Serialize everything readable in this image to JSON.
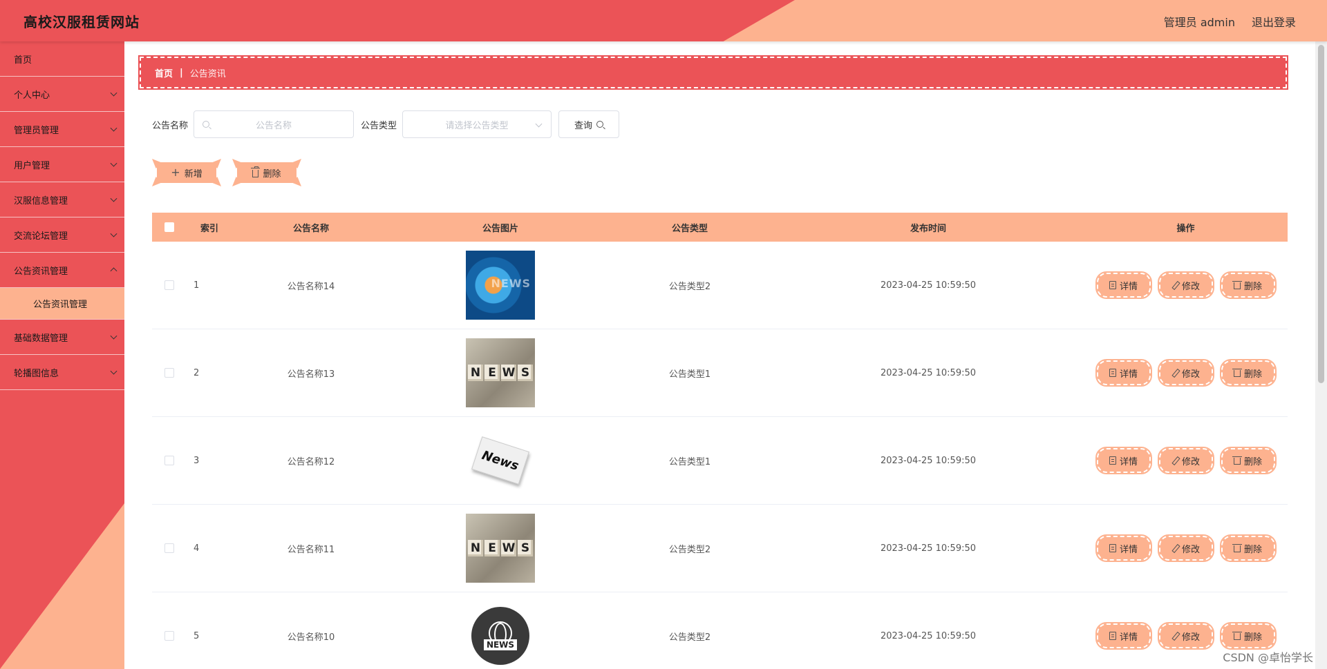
{
  "header": {
    "site_title": "高校汉服租赁网站",
    "user_label": "管理员 admin",
    "logout_label": "退出登录"
  },
  "sidebar": {
    "items": [
      {
        "label": "首页"
      },
      {
        "label": "个人中心"
      },
      {
        "label": "管理员管理"
      },
      {
        "label": "用户管理"
      },
      {
        "label": "汉服信息管理"
      },
      {
        "label": "交流论坛管理"
      },
      {
        "label": "公告资讯管理"
      },
      {
        "label": "基础数据管理"
      },
      {
        "label": "轮播图信息"
      }
    ],
    "submenu_label": "公告资讯管理"
  },
  "breadcrumb": {
    "home": "首页",
    "separator": "|",
    "current": "公告资讯"
  },
  "search": {
    "name_label": "公告名称",
    "name_placeholder": "公告名称",
    "type_label": "公告类型",
    "type_placeholder": "请选择公告类型",
    "query_label": "查询"
  },
  "actions": {
    "add_label": "新增",
    "delete_label": "删除"
  },
  "table": {
    "headers": [
      "索引",
      "公告名称",
      "公告图片",
      "公告类型",
      "发布时间",
      "操作"
    ],
    "rows": [
      {
        "index": "1",
        "name": "公告名称14",
        "image": "news-globe-image",
        "type": "公告类型2",
        "time": "2023-04-25 10:59:50"
      },
      {
        "index": "2",
        "name": "公告名称13",
        "image": "news-cubes-image",
        "type": "公告类型1",
        "time": "2023-04-25 10:59:50"
      },
      {
        "index": "3",
        "name": "公告名称12",
        "image": "newspaper-image",
        "type": "公告类型1",
        "time": "2023-04-25 10:59:50"
      },
      {
        "index": "4",
        "name": "公告名称11",
        "image": "news-cubes-image",
        "type": "公告类型2",
        "time": "2023-04-25 10:59:50"
      },
      {
        "index": "5",
        "name": "公告名称10",
        "image": "news-globe-badge-image",
        "type": "公告类型2",
        "time": "2023-04-25 10:59:50"
      }
    ],
    "ops": {
      "detail": "详情",
      "edit": "修改",
      "delete": "删除"
    },
    "image_text": {
      "news_word": "NEWS",
      "news_cubes": [
        "N",
        "E",
        "W",
        "S"
      ],
      "newspaper": "News"
    }
  },
  "watermark": "CSDN @卓怡学长",
  "colors": {
    "primary_red": "#EB5357",
    "accent_peach": "#FDB28F"
  }
}
